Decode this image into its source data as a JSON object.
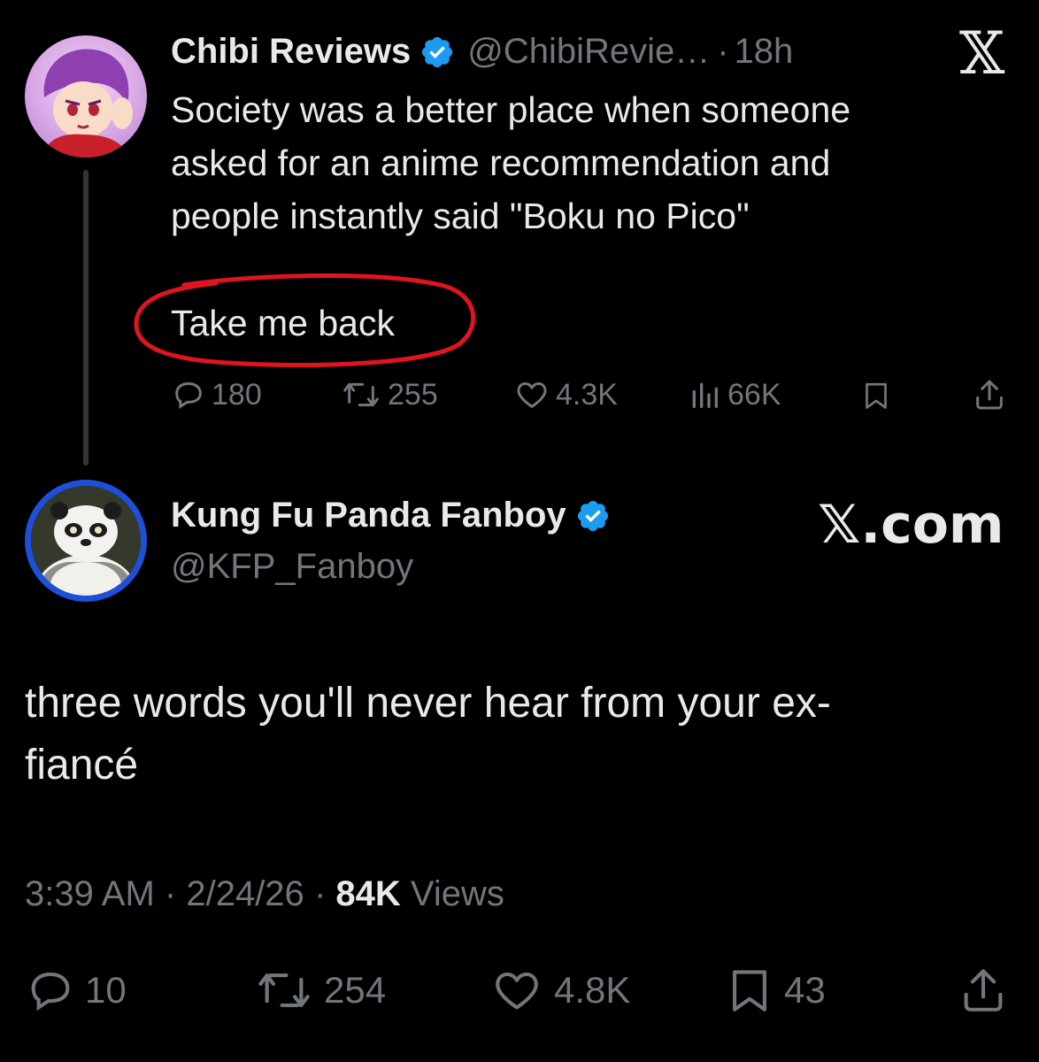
{
  "quoted": {
    "display_name": "Chibi Reviews",
    "handle": "@ChibiRevie…",
    "separator": "·",
    "time": "18h",
    "text_lines": [
      "Society was a better place when someone",
      "asked for an anime recommendation and",
      "people instantly said \"Boku no Pico\""
    ],
    "text_circled": "Take me back",
    "actions": {
      "replies": "180",
      "reposts": "255",
      "likes": "4.3K",
      "views": "66K"
    },
    "logo": "𝕏"
  },
  "main": {
    "display_name": "Kung Fu Panda Fanboy",
    "handle": "@KFP_Fanboy",
    "watermark": "𝕏.com",
    "text_lines": [
      "three words you'll never hear from your ex-",
      "fiancé"
    ],
    "time": "3:39 AM",
    "date": "2/24/26",
    "views_count": "84K",
    "views_label": "Views",
    "separator": "·",
    "actions": {
      "replies": "10",
      "reposts": "254",
      "likes": "4.8K",
      "bookmarks": "43"
    }
  },
  "colors": {
    "background": "#000000",
    "text": "#e7e9ea",
    "muted": "#71767b",
    "verified": "#1d9bf0",
    "annotation_circle": "#e0141e",
    "avatar_ring": "#1d4fd8"
  },
  "icons": [
    "verified-badge-icon",
    "x-logo-icon",
    "reply-icon",
    "repost-icon",
    "like-icon",
    "views-icon",
    "bookmark-icon",
    "share-icon"
  ]
}
